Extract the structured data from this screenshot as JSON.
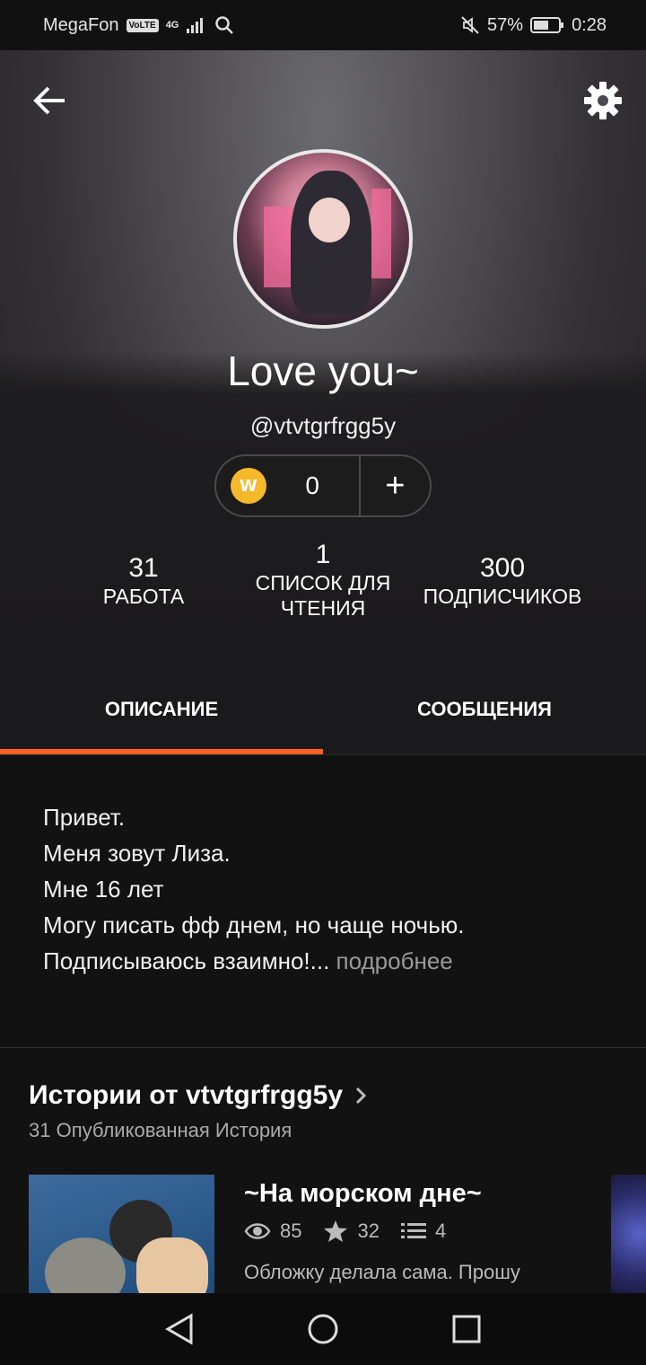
{
  "status_bar": {
    "carrier": "MegaFon",
    "volte": "VoLTE",
    "network": "4G",
    "battery": "57%",
    "time": "0:28"
  },
  "header": {
    "back_icon": "arrow-left-icon",
    "settings_icon": "gear-icon"
  },
  "profile": {
    "display_name": "Love you~",
    "username": "@vtvtgrfrgg5y",
    "coins": "0",
    "coin_symbol": "W",
    "add_symbol": "+"
  },
  "stats": [
    {
      "value": "31",
      "label": "РАБОТА"
    },
    {
      "value": "1",
      "label": "СПИСОК ДЛЯ ЧТЕНИЯ"
    },
    {
      "value": "300",
      "label": "ПОДПИСЧИКОВ"
    }
  ],
  "tabs": {
    "about": "ОПИСАНИЕ",
    "messages": "СООБЩЕНИЯ",
    "active": "about"
  },
  "about": {
    "lines": [
      "Привет.",
      "Меня зовут Лиза.",
      "Мне 16 лет",
      "Могу писать фф днем, но чаще ночью.",
      "Подписываюсь взаимно!..."
    ],
    "more_link": " подробнее"
  },
  "stories": {
    "title": "Истории от vtvtgrfrgg5y",
    "subtitle": "31 Опубликованная История",
    "items": [
      {
        "title": "~На морском дне~",
        "views": "85",
        "votes": "32",
        "parts": "4",
        "description": "Обложку делала сама. Прошу"
      }
    ]
  },
  "colors": {
    "accent": "#ff6122",
    "coin": "#f6b92b",
    "background": "#121212"
  }
}
